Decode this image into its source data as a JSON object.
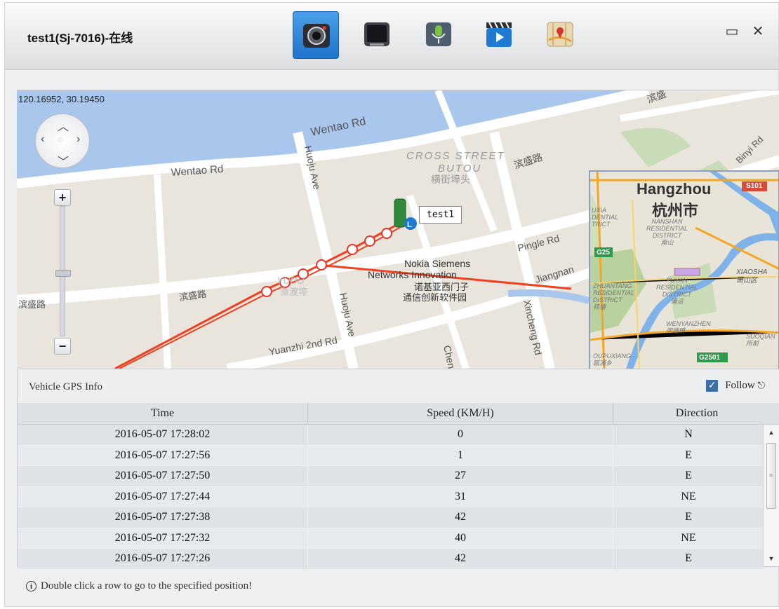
{
  "window": {
    "title": "test1(Sj-7016)-在线",
    "toolbar": [
      {
        "name": "camera-icon",
        "active": true
      },
      {
        "name": "monitor-icon",
        "active": false
      },
      {
        "name": "microphone-icon",
        "active": false
      },
      {
        "name": "video-clip-icon",
        "active": false
      },
      {
        "name": "map-pin-icon",
        "active": false
      }
    ],
    "minimize_glyph": "▭",
    "close_glyph": "✕"
  },
  "map": {
    "coordinates": "120.16952, 30.19450",
    "zoom_in": "+",
    "zoom_out": "−",
    "vehicle_label": "test1",
    "labels": {
      "wentao_rd_1": "Wentao Rd",
      "wentao_rd_2": "Wentao Rd",
      "cross_street_1": "CROSS STREET",
      "cross_street_2": "BUTOU",
      "cross_street_cn": "横街埠头",
      "binsheng_1": "滨盛路",
      "binsheng_2": "滨盛路",
      "binsheng_3": "滨盛路",
      "binsheng_4": "滨盛",
      "huoju_ave_1": "Huoju Ave",
      "huoju_ave_2": "Huoju Ave",
      "binyi_rd": "Binyi Rd",
      "pingle_rd": "Pingle Rd",
      "jiangnan": "Jiangnan",
      "nokia_1": "Nokia Siemens",
      "nokia_2": "Networks Innovation",
      "nokia_cn_1": "诺基亚西门子",
      "nokia_cn_2": "通信创新软件园",
      "yubu": "YUDU",
      "yubu_cn": "渔渡埠",
      "yuanzhi": "Yuanzhi 2nd Rd",
      "xincheng": "Xincheng Rd",
      "chen": "Chen"
    },
    "inset": {
      "city": "Hangzhou",
      "city_cn": "杭州市",
      "nanshan": "NANSHAN",
      "nanshan_2": "RESIDENTIAL",
      "nanshan_3": "DISTRICT",
      "nanshan_cn": "南山",
      "xiaosha": "XIAOSHA",
      "xiaosha_cn": "萧山区",
      "zhuantang": "ZHUANTANG",
      "zhuantang_2": "RESIDENTIAL",
      "zhuantang_3": "DISTRICT",
      "zhuantang_cn": "转塘",
      "puyan": "PUYAN",
      "puyan_2": "RESIDENTIAL",
      "puyan_3": "DISTRICT",
      "puyan_cn": "浦沿",
      "wenyanzhen": "WENYANZHEN",
      "wenyanzhen_cn": "闻堰镇",
      "suoqian": "SUOQIAN",
      "suoqian_cn": "所前",
      "oupuxiang": "OUPUXIANG",
      "oupuxiang_cn": "瓯浦乡",
      "uxia": "UXIA",
      "dential": "DENTIAL",
      "trict": "TRICT",
      "s101": "S101",
      "g25": "G25",
      "g2501": "G2501"
    }
  },
  "gps_panel": {
    "title": "Vehicle GPS Info",
    "follow_checked": true,
    "follow_label": "Follow",
    "columns": [
      "Time",
      "Speed (KM/H)",
      "Direction"
    ],
    "rows": [
      {
        "time": "2016-05-07 17:28:02",
        "speed": "0",
        "direction": "N"
      },
      {
        "time": "2016-05-07 17:27:56",
        "speed": "1",
        "direction": "E"
      },
      {
        "time": "2016-05-07 17:27:50",
        "speed": "27",
        "direction": "E"
      },
      {
        "time": "2016-05-07 17:27:44",
        "speed": "31",
        "direction": "NE"
      },
      {
        "time": "2016-05-07 17:27:38",
        "speed": "42",
        "direction": "E"
      },
      {
        "time": "2016-05-07 17:27:32",
        "speed": "40",
        "direction": "NE"
      },
      {
        "time": "2016-05-07 17:27:26",
        "speed": "42",
        "direction": "E"
      }
    ]
  },
  "footer": {
    "hint": "Double click a row to go to the specified position!"
  }
}
